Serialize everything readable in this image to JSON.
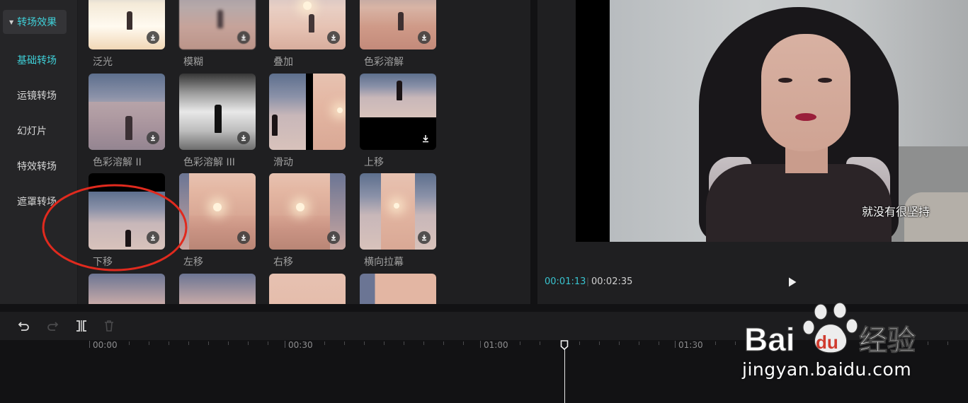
{
  "sidebar": {
    "header": "转场效果",
    "items": [
      {
        "label": "基础转场",
        "active": true
      },
      {
        "label": "运镜转场",
        "active": false
      },
      {
        "label": "幻灯片",
        "active": false
      },
      {
        "label": "特效转场",
        "active": false
      },
      {
        "label": "遮罩转场",
        "active": false
      }
    ]
  },
  "effects": [
    {
      "label": "泛光"
    },
    {
      "label": "模糊"
    },
    {
      "label": "叠加"
    },
    {
      "label": "色彩溶解"
    },
    {
      "label": "色彩溶解 II"
    },
    {
      "label": "色彩溶解 III"
    },
    {
      "label": "滑动"
    },
    {
      "label": "上移"
    },
    {
      "label": "下移"
    },
    {
      "label": "左移"
    },
    {
      "label": "右移"
    },
    {
      "label": "横向拉幕"
    }
  ],
  "preview": {
    "subtitle": "就没有很坚持",
    "current_time": "00:01:13",
    "separator": "|",
    "total_time": "00:02:35"
  },
  "timeline": {
    "ticks": [
      "00:00",
      "00:30",
      "01:00",
      "01:30"
    ]
  },
  "watermark": {
    "logo_text": "Bai du 经验",
    "url": "jingyan.baidu.com"
  },
  "colors": {
    "accent": "#3fd0d8",
    "annotation": "#e02a1e"
  }
}
